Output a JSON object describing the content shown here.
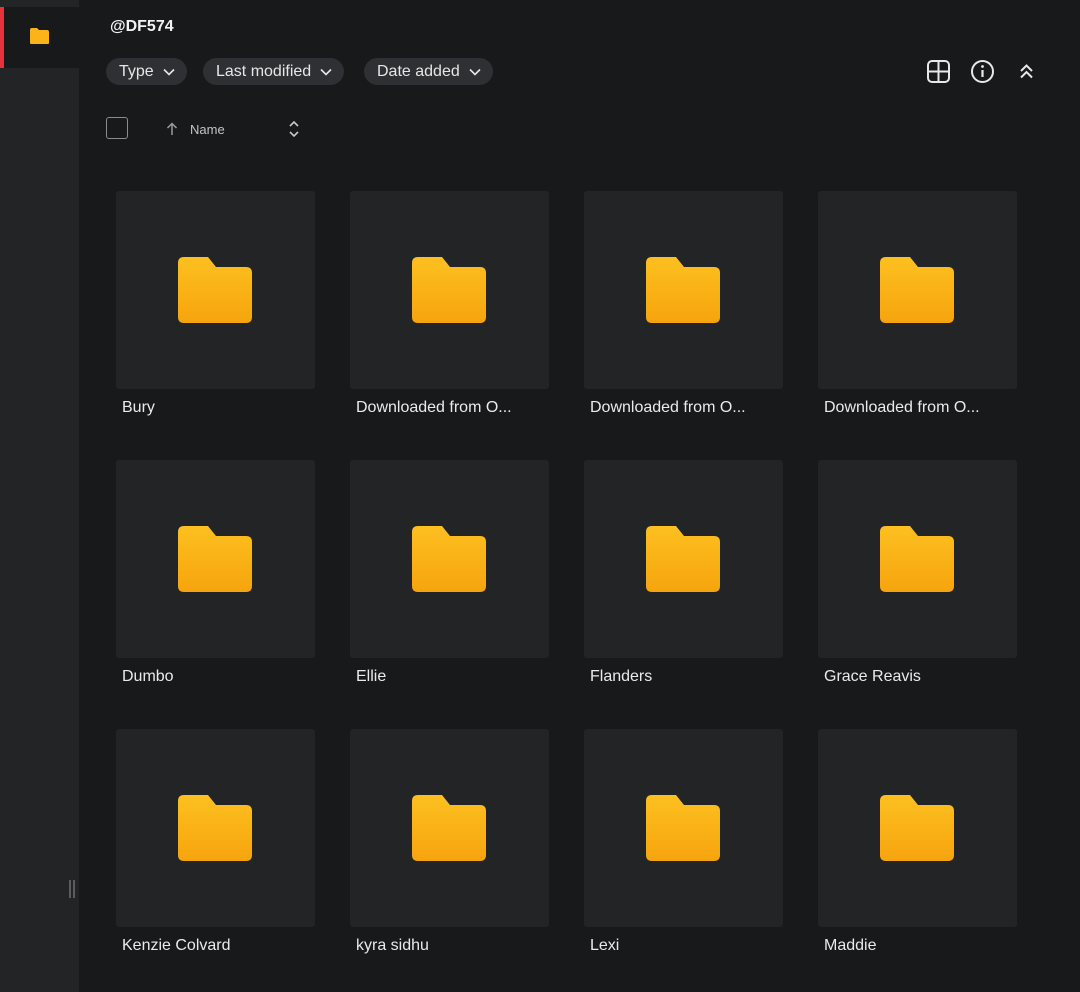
{
  "header": {
    "title": "@DF574"
  },
  "filters": [
    {
      "label": "Type"
    },
    {
      "label": "Last modified"
    },
    {
      "label": "Date added"
    }
  ],
  "toolbar_icons": [
    "grid-view-icon",
    "info-icon",
    "collapse-icon"
  ],
  "sort": {
    "label": "Name",
    "direction_icon": "arrow-up-icon",
    "toggle_icon": "sort-toggle-icon"
  },
  "items": [
    {
      "name": "Bury"
    },
    {
      "name": "Downloaded from O..."
    },
    {
      "name": "Downloaded from O..."
    },
    {
      "name": "Downloaded from O..."
    },
    {
      "name": "Dumbo"
    },
    {
      "name": "Ellie"
    },
    {
      "name": "Flanders"
    },
    {
      "name": "Grace Reavis"
    },
    {
      "name": "Kenzie Colvard"
    },
    {
      "name": "kyra sidhu"
    },
    {
      "name": "Lexi"
    },
    {
      "name": "Maddie"
    }
  ],
  "colors": {
    "accent": "#e5323b",
    "folder_top": "#fdc020",
    "folder_bottom": "#f6a40d",
    "background": "#18191a",
    "tile": "#232426"
  }
}
